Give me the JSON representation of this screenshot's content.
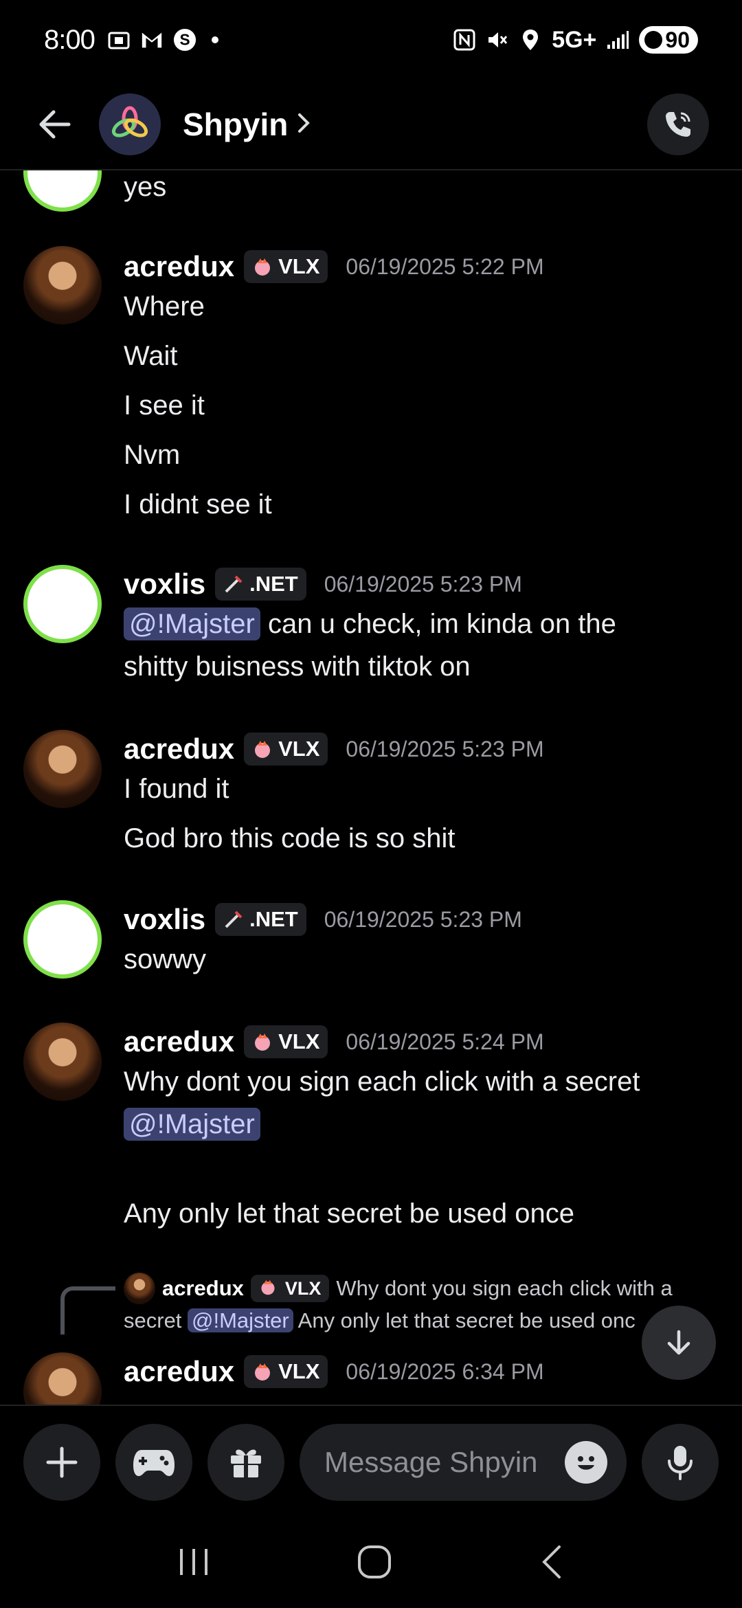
{
  "status_bar": {
    "time": "8:00",
    "network": "5G+",
    "battery": "90"
  },
  "header": {
    "channel_name": "Shpyin"
  },
  "messages": {
    "top_fragment": {
      "text": "yes"
    },
    "m1": {
      "author": "acredux",
      "tag": "VLX",
      "timestamp": "06/19/2025 5:22 PM",
      "lines": [
        "Where",
        "Wait",
        "I see it",
        "Nvm",
        "I didnt see it"
      ]
    },
    "m2": {
      "author": "voxlis",
      "tag": ".NET",
      "timestamp": "06/19/2025 5:23 PM",
      "mention": "@!Majster",
      "line1_rest": " can u check, im kinda on the",
      "line2": "shitty buisness with tiktok on"
    },
    "m3": {
      "author": "acredux",
      "tag": "VLX",
      "timestamp": "06/19/2025 5:23 PM",
      "lines": [
        "I found it",
        "God bro this code is so shit"
      ]
    },
    "m4": {
      "author": "voxlis",
      "tag": ".NET",
      "timestamp": "06/19/2025 5:23 PM",
      "lines": [
        "sowwy"
      ]
    },
    "m5": {
      "author": "acredux",
      "tag": "VLX",
      "timestamp": "06/19/2025 5:24 PM",
      "line1": "Why dont you sign each click with a secret",
      "mention": "@!Majster",
      "line3": "Any only let that secret be used once"
    },
    "reply": {
      "author": "acredux",
      "tag": "VLX",
      "text1": "Why dont you sign each click with a",
      "text2_pre": "secret ",
      "mention": "@!Majster",
      "text2_post": " Any only let that secret be used onc"
    },
    "m6": {
      "author": "acredux",
      "tag": "VLX",
      "timestamp": "06/19/2025 6:34 PM"
    }
  },
  "composer": {
    "placeholder": "Message Shpyin"
  }
}
